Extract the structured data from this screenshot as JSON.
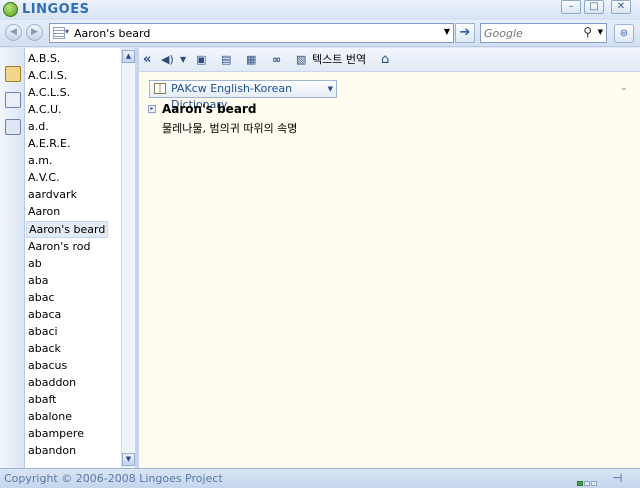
{
  "app": {
    "title": "LINGOES",
    "window_buttons": [
      "–",
      "□",
      "✕"
    ]
  },
  "addressbar": {
    "back_icon": "◀",
    "forward_icon": "▶",
    "query": "Aaron's beard",
    "go_icon": "➔",
    "google_placeholder": "Google",
    "search_icon": "⚲",
    "menu_icon": "⊜"
  },
  "wordlist": {
    "selected": "Aaron's beard",
    "items": [
      "A.B.S.",
      "A.C.I.S.",
      "A.C.L.S.",
      "A.C.U.",
      "a.d.",
      "A.E.R.E.",
      "a.m.",
      "A.V.C.",
      "aardvark",
      "Aaron",
      "Aaron's beard",
      "Aaron's rod",
      "ab",
      "aba",
      "abac",
      "abaca",
      "abaci",
      "aback",
      "abacus",
      "abaddon",
      "abaft",
      "abalone",
      "abampere",
      "abandon"
    ]
  },
  "toolbar": {
    "collapse_icon": "«",
    "translate_label": "텍스트 번역",
    "home_icon": "⌂"
  },
  "dictionary": {
    "name": "PAKcw English-Korean Dictionary",
    "headword": "Aaron's beard",
    "definition": "물레나물, 범의귀 따위의 속명"
  },
  "status": {
    "copyright": "Copyright © 2006-2008 Lingoes Project"
  },
  "colors": {
    "brand": "#2f6db7",
    "content_bg": "#fefdf0",
    "status_text": "#5b78a6"
  }
}
